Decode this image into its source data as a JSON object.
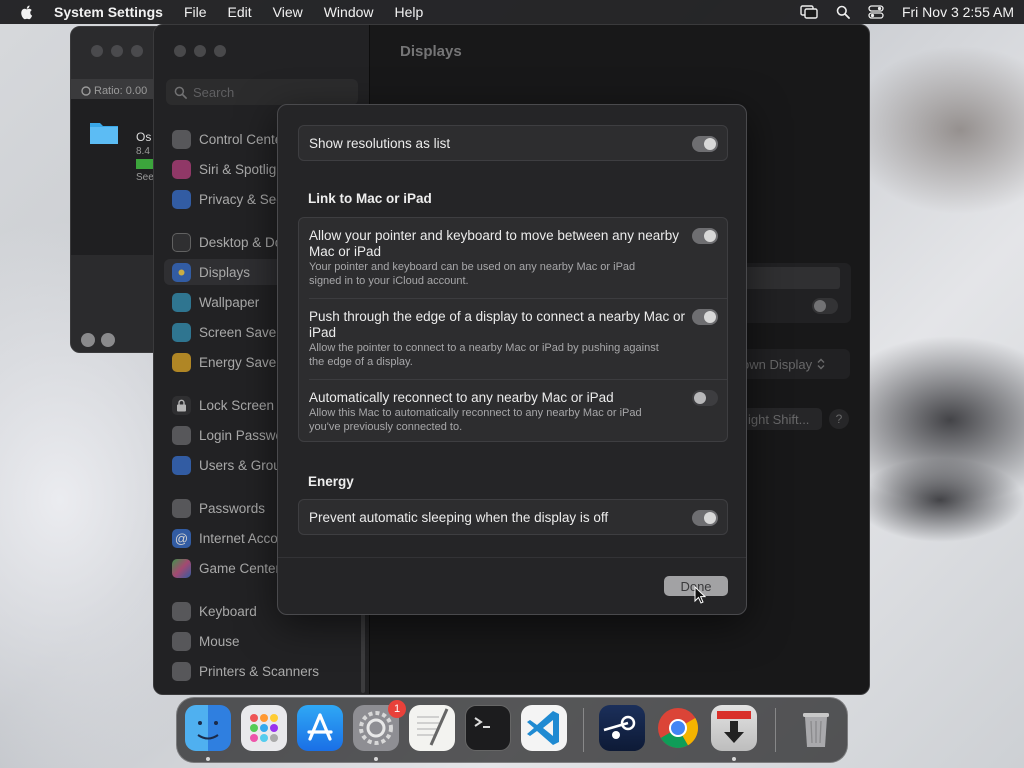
{
  "menubar": {
    "app_name": "System Settings",
    "items": [
      "File",
      "Edit",
      "View",
      "Window",
      "Help"
    ],
    "clock": "Fri Nov 3  2:55 AM"
  },
  "finder": {
    "ratio": "Ratio: 0.00",
    "file_name": "Os",
    "file_size": "8.4",
    "see": "See"
  },
  "settings": {
    "search_placeholder": "Search",
    "content_title": "Displays",
    "content_select": "own Display",
    "content_button": "ight Shift...",
    "content_help": "?",
    "sidebar": [
      {
        "label": "Control Center",
        "color": "#6b6b6e"
      },
      {
        "label": "Siri & Spotlight",
        "color": "#b0457e"
      },
      {
        "label": "Privacy & Security",
        "color": "#3e71c7"
      },
      {
        "label": "Desktop & Dock",
        "color": "#3a3a3c"
      },
      {
        "label": "Displays",
        "color": "#3e71c7"
      },
      {
        "label": "Wallpaper",
        "color": "#3a8fb0"
      },
      {
        "label": "Screen Saver",
        "color": "#3a8fb0"
      },
      {
        "label": "Energy Saver",
        "color": "#d7a42e"
      },
      {
        "label": "Lock Screen",
        "color": "#3a3a3c"
      },
      {
        "label": "Login Password",
        "color": "#6b6b6e"
      },
      {
        "label": "Users & Groups",
        "color": "#3e71c7"
      },
      {
        "label": "Passwords",
        "color": "#6b6b6e"
      },
      {
        "label": "Internet Accounts",
        "color": "#3e71c7"
      },
      {
        "label": "Game Center",
        "color": "#c95a8a"
      },
      {
        "label": "Keyboard",
        "color": "#6b6b6e"
      },
      {
        "label": "Mouse",
        "color": "#6b6b6e"
      },
      {
        "label": "Printers & Scanners",
        "color": "#6b6b6e"
      }
    ]
  },
  "sheet": {
    "show_resolutions": {
      "label": "Show resolutions as list",
      "on": true
    },
    "link_heading": "Link to Mac or iPad",
    "link_rows": [
      {
        "label": "Allow your pointer and keyboard to move between any nearby Mac or iPad",
        "desc": "Your pointer and keyboard can be used on any nearby Mac or iPad signed in to your iCloud account.",
        "on": true
      },
      {
        "label": "Push through the edge of a display to connect a nearby Mac or iPad",
        "desc": "Allow the pointer to connect to a nearby Mac or iPad by pushing against the edge of a display.",
        "on": true
      },
      {
        "label": "Automatically reconnect to any nearby Mac or iPad",
        "desc": "Allow this Mac to automatically reconnect to any nearby Mac or iPad you've previously connected to.",
        "on": false
      }
    ],
    "energy_heading": "Energy",
    "prevent_sleep": {
      "label": "Prevent automatic sleeping when the display is off",
      "on": true
    },
    "done_label": "Done"
  },
  "dock": {
    "settings_badge": "1",
    "apps": [
      {
        "name": "finder-icon"
      },
      {
        "name": "launchpad-icon"
      },
      {
        "name": "app-store-icon"
      },
      {
        "name": "system-settings-icon"
      },
      {
        "name": "textedit-icon"
      },
      {
        "name": "terminal-icon"
      },
      {
        "name": "vscode-icon"
      },
      {
        "name": "steam-icon"
      },
      {
        "name": "chrome-icon"
      },
      {
        "name": "downloader-icon"
      },
      {
        "name": "trash-icon"
      }
    ]
  }
}
